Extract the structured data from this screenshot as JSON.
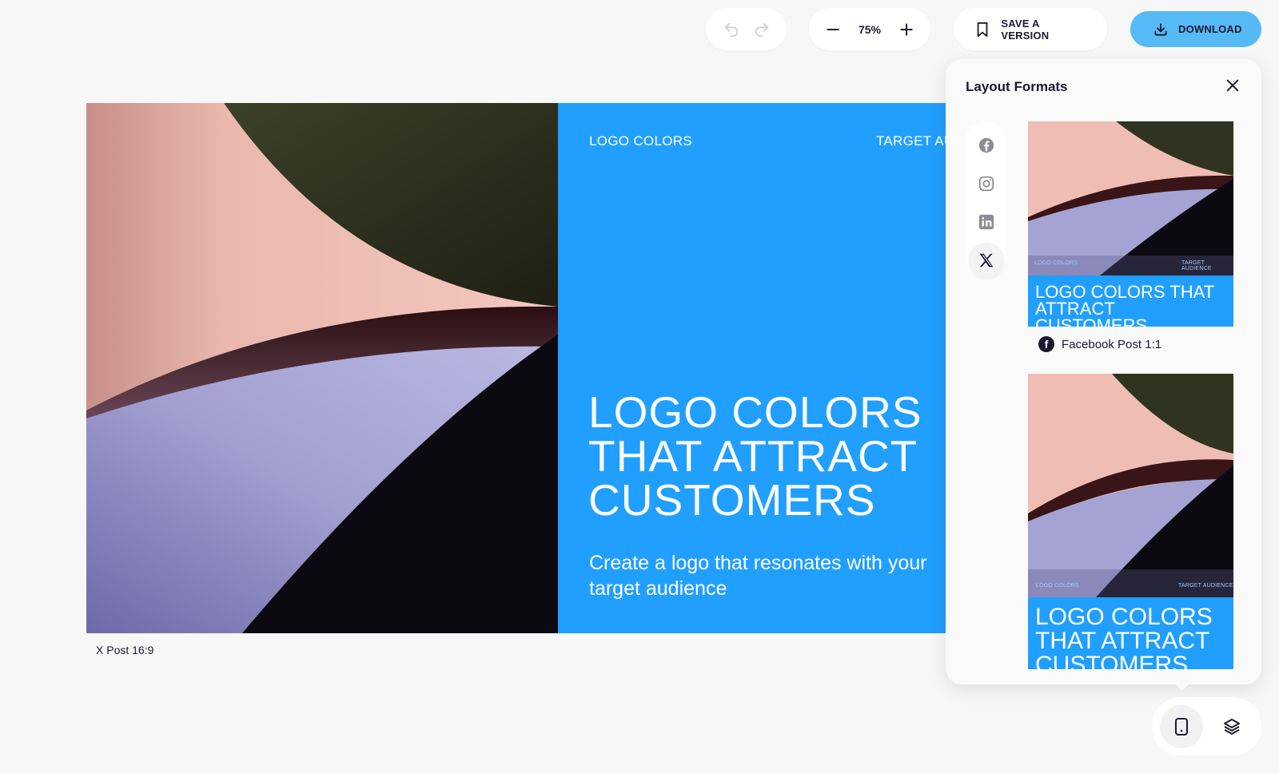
{
  "toolbar": {
    "zoom_value": "75%",
    "save_label": "SAVE A VERSION",
    "download_label": "DOWNLOAD"
  },
  "canvas": {
    "top_left": "LOGO COLORS",
    "top_right": "TARGET AUDIENCE",
    "headline": "LOGO COLORS\nTHAT ATTRACT\nCUSTOMERS",
    "subtitle": "Create a logo that resonates with your\ntarget audience",
    "format_label": "X Post 16:9"
  },
  "formats_panel": {
    "title": "Layout Formats",
    "social": [
      "facebook-icon",
      "instagram-icon",
      "linkedin-icon",
      "x-icon"
    ],
    "active_social": "x-icon",
    "thumbnails": [
      {
        "mini_left": "LOGO COLORS",
        "mini_right": "TARGET AUDIENCE",
        "headline": "LOGO COLORS THAT\nATTRACT CUSTOMERS",
        "caption": "Facebook Post 1:1"
      },
      {
        "mini_left": "LOGO COLORS",
        "mini_right": "TARGET AUDIENCE",
        "headline": "LOGO COLORS\nTHAT ATTRACT\nCUSTOMERS"
      }
    ]
  },
  "colors": {
    "accent_blue": "#219ffe",
    "download_blue": "#56baf6",
    "pink": "#efbdb3",
    "lavender": "#a5a3d3",
    "dark_olive": "#2f3420",
    "ink": "#1a1a2e"
  }
}
